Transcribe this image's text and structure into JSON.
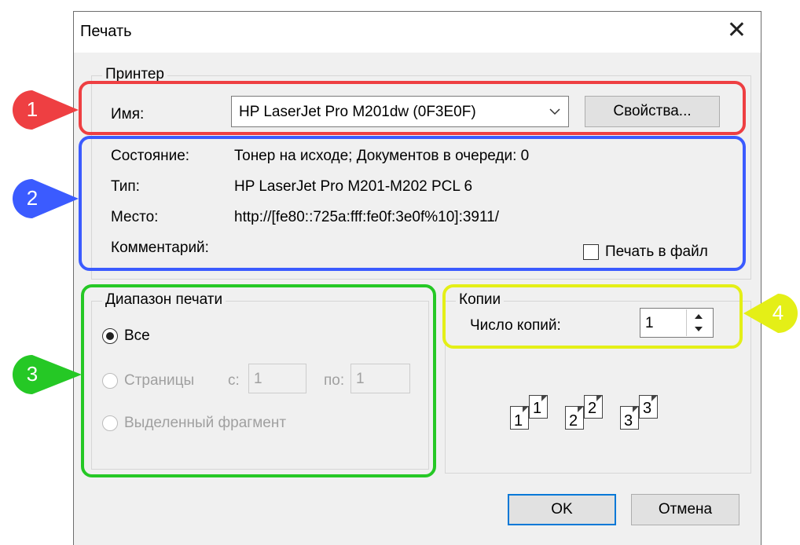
{
  "dialog": {
    "title": "Печать",
    "close_glyph": "✕"
  },
  "printer": {
    "group_label": "Принтер",
    "name_label": "Имя:",
    "name_value": "HP LaserJet Pro M201dw (0F3E0F)",
    "properties_button": "Свойства...",
    "status_label": "Состояние:",
    "status_value": "Тонер на исходе; Документов в очереди: 0",
    "type_label": "Тип:",
    "type_value": "HP LaserJet Pro M201-M202 PCL 6",
    "place_label": "Место:",
    "place_value": "http://[fe80::725a:fff:fe0f:3e0f%10]:3911/",
    "comment_label": "Комментарий:",
    "print_to_file_label": "Печать в файл",
    "print_to_file_checked": false
  },
  "range": {
    "group_label": "Диапазон печати",
    "all_label": "Все",
    "pages_label": "Страницы",
    "from_label": "с:",
    "from_value": "1",
    "to_label": "по:",
    "to_value": "1",
    "selection_label": "Выделенный фрагмент",
    "selected": "all"
  },
  "copies": {
    "group_label": "Копии",
    "count_label": "Число копий:",
    "count_value": "1",
    "collate_pages": [
      "1",
      "1",
      "2",
      "2",
      "3",
      "3"
    ]
  },
  "buttons": {
    "ok": "OK",
    "cancel": "Отмена"
  },
  "callouts": [
    {
      "number": "1",
      "color": "#ee3f42"
    },
    {
      "number": "2",
      "color": "#3b5bff"
    },
    {
      "number": "3",
      "color": "#25c825"
    },
    {
      "number": "4",
      "color": "#e4ef17"
    }
  ]
}
